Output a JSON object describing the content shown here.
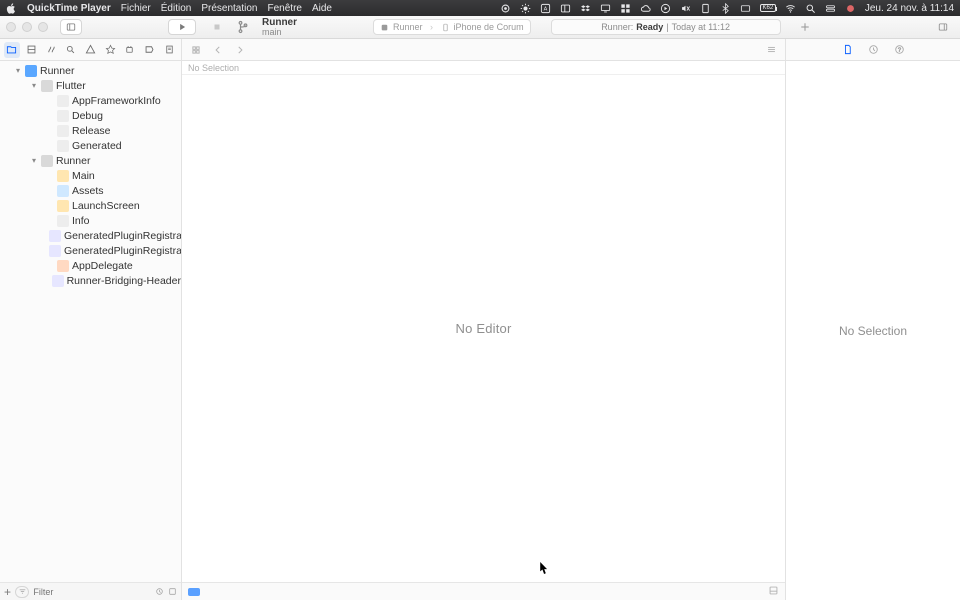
{
  "menubar": {
    "app": "QuickTime Player",
    "items": [
      "Fichier",
      "Édition",
      "Présentation",
      "Fenêtre",
      "Aide"
    ],
    "clock": "Jeu. 24 nov. à 11:14",
    "battery": "K62"
  },
  "toolbar": {
    "scheme_name": "Runner",
    "scheme_branch": "main",
    "run_dest_app": "Runner",
    "run_dest_device": "iPhone de Corum",
    "status_prefix": "Runner:",
    "status_state": "Ready",
    "status_sep": "|",
    "status_time": "Today at 11:12"
  },
  "jumpbar": {
    "no_selection": "No Selection"
  },
  "tree": {
    "root": "Runner",
    "groups": [
      {
        "name": "Flutter",
        "children": [
          "AppFrameworkInfo",
          "Debug",
          "Release",
          "Generated"
        ]
      },
      {
        "name": "Runner",
        "children": [
          "Main",
          "Assets",
          "LaunchScreen",
          "Info",
          "GeneratedPluginRegistrant",
          "GeneratedPluginRegistrant",
          "AppDelegate",
          "Runner-Bridging-Header"
        ]
      }
    ]
  },
  "filter": {
    "placeholder": "Filter"
  },
  "editor": {
    "empty": "No Editor"
  },
  "inspector": {
    "empty": "No Selection"
  }
}
